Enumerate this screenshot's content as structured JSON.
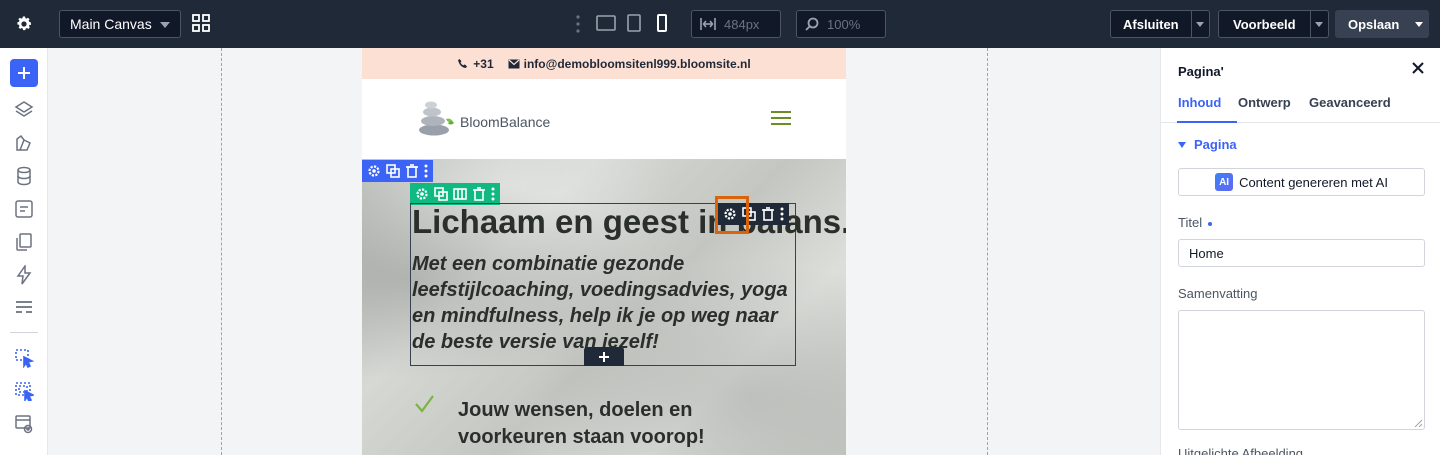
{
  "topbar": {
    "canvas_select": "Main Canvas",
    "width_value": "484px",
    "zoom_value": "100%",
    "close_label": "Afsluiten",
    "preview_label": "Voorbeeld",
    "save_label": "Opslaan"
  },
  "site": {
    "phone": "+31",
    "email": "info@demobloomsitenl999.bloomsite.nl",
    "logo_text": "BloomBalance",
    "hero_title": "Lichaam en geest in balans.",
    "hero_subtitle": "Met een combinatie gezonde leefstijlcoaching, voedingsadvies, yoga en mindfulness, help ik je op weg naar de beste versie van jezelf!",
    "feature_text": "Jouw wensen, doelen en voorkeuren staan voorop!"
  },
  "panel": {
    "title": "Pagina'",
    "tabs": [
      "Inhoud",
      "Ontwerp",
      "Geavanceerd"
    ],
    "section": "Pagina",
    "ai_badge": "AI",
    "ai_button": "Content genereren met AI",
    "title_label": "Titel",
    "title_value": "Home",
    "summary_label": "Samenvatting",
    "featured_label": "Uitgelichte Afbeelding"
  },
  "colors": {
    "accent": "#3b63f6",
    "topbar": "#1f2937",
    "element_toolbar": "#10b981",
    "highlight": "#d9640c",
    "contact_bar": "#fde0d4"
  }
}
